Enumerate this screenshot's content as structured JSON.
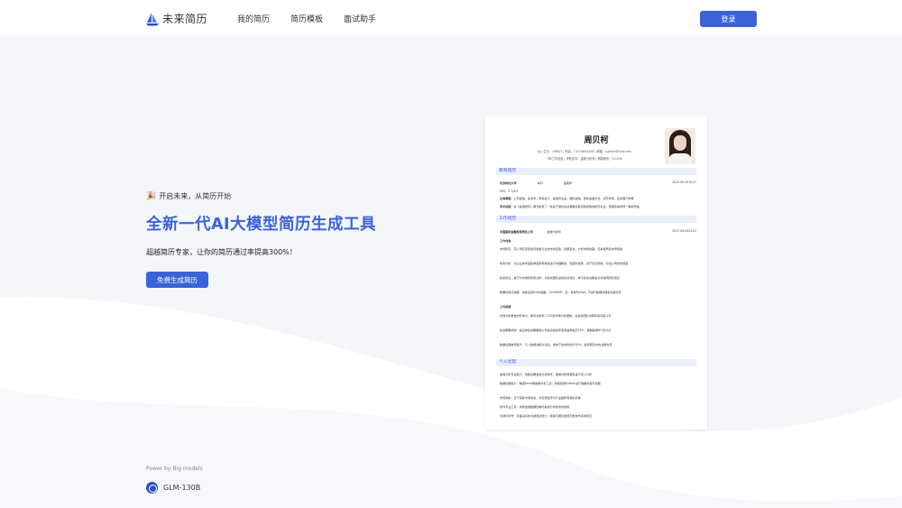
{
  "header": {
    "logo_text": "未来简历",
    "nav": [
      "我的简历",
      "简历模板",
      "面试助手"
    ],
    "login_label": "登录"
  },
  "hero": {
    "tagline": "开启未来，从简历开始",
    "title": "全新一代AI大模型简历生成工具",
    "subtitle": "超越简历专家，让你的简历通过率提高300%！",
    "cta_label": "免费生成简历"
  },
  "footer": {
    "powered": "Power by Big models",
    "model_name": "GLM-130B"
  },
  "resume": {
    "name": "周贝柯",
    "info1": "女 | 生日：1995/1 | 电话：13574654438 | 邮箱：custom@cvfy.com",
    "info2": "3年工作经验 | 求职意向：金融分析师 | 期望薪资：10-20k",
    "sections": {
      "education": "教育经历",
      "work": "工作经历",
      "advantages": "个人优势"
    },
    "edu_school": "北京科技大学",
    "edu_degree": "本科",
    "edu_major": "金融学",
    "edu_dates": "2015.09-2019.07",
    "edu_gpa": "GPA：3.7/4.0",
    "edu_course_label": "主修课程：",
    "edu_course": "公司金融、投资学、财务会计、金融衍生品、国际金融、量化金融方法、货币市场、投资银行学等",
    "edu_research_label": "学术成就：",
    "edu_research": "在《金融研究》期刊发表了一篇关于量化投资策略及其风险控制的研究论文，选题获得导师一等奖学金。",
    "work_company": "中国国际金融有限责任公司",
    "work_role": "金融分析师",
    "work_dates": "2017.04-2024.01",
    "work_content_label": "工作内容",
    "work_lines": [
      "市场研究：深入研究宏观经济和各行业的市场走势、政策变化，分析市场供需、竞争格局和市场情绪",
      "财务分析：对企业的年度和季度财务报告进行详细解读，包括利润表、资产负债表等，评估公司财务健康",
      "投资建议：基于对市场和财务分析，为投资团队提供投资建议，参与投资决策会议并说明研究观点",
      "数据处理与建模：熟练运用Excel函数、VLOOKUP、宏，使用Python、R进行数据处理和建模分析"
    ],
    "work_results_label": "工作成绩",
    "work_results": [
      "市场分析报告的影响力：撰写并发布了120篇市场分析报告，在投资团队内部获得高度认可",
      "投资策略成效：提出的投资策略使公司投资组合年度收益率提高15%，超越基准8个百分点",
      "数据处理效率提升：引入数据建模方法后，报告产出效率提升30%，提供更及时的决策支持"
    ],
    "adv_lines": [
      "金融分析专业能力：熟练掌握金融分析技术，能够对财务报表进行深入分析",
      "数据处理能力：精通Excel等数据分析工具，熟练使用Python进行数据处理与建模",
      "市场洞察：善于追踪市场动态，对宏观经济与行业趋势有独到见解",
      "软件专业工具：熟悉金融数据终端与各类分析软件的使用",
      "沟通与协作：具备良好的沟通表达能力，能够与团队成员高效协作完成项目"
    ]
  },
  "colors": {
    "accent": "#3a63d8",
    "page_bg": "#f4f6fa"
  }
}
